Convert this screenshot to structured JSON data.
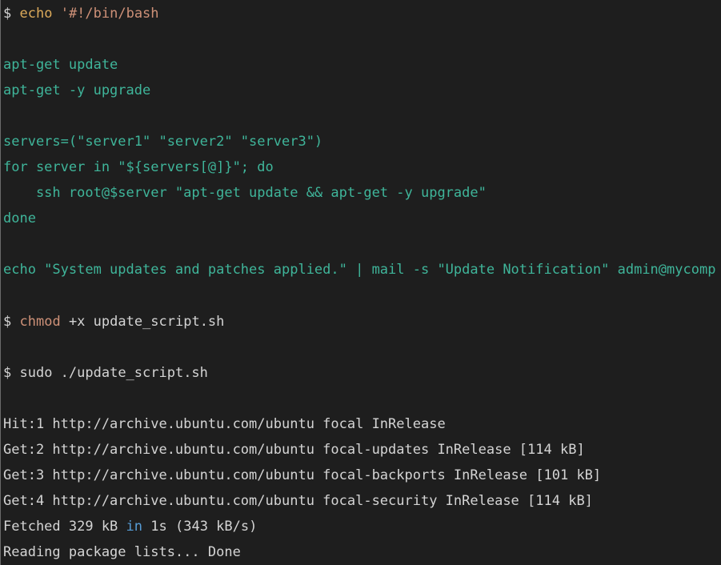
{
  "colors": {
    "background": "#1e1e1e",
    "default_text": "#d4d4d4",
    "string": "#ce9178",
    "command": "#dcaa5a",
    "script_body": "#3fb59a",
    "keyword": "#569cd6"
  },
  "lines": [
    {
      "prompt": "$",
      "cmd": "echo",
      "arg": "'#!/bin/bash"
    },
    {
      "text": "apt-get update"
    },
    {
      "text": "apt-get -y upgrade"
    },
    {
      "text": "servers=(\"server1\" \"server2\" \"server3\")"
    },
    {
      "text": "for server in \"${servers[@]}\"; do"
    },
    {
      "text": "    ssh root@$server \"apt-get update && apt-get -y upgrade\""
    },
    {
      "text": "done"
    },
    {
      "text": "echo \"System updates and patches applied.\" | mail -s \"Update Notification\" admin@mycomp"
    },
    {
      "prompt": "$",
      "cmd": "chmod",
      "arg": "+x update_script.sh"
    },
    {
      "prompt": "$",
      "text": "sudo ./update_script.sh"
    },
    {
      "text": "Hit:1 http://archive.ubuntu.com/ubuntu focal InRelease"
    },
    {
      "text": "Get:2 http://archive.ubuntu.com/ubuntu focal-updates InRelease [114 kB]"
    },
    {
      "text": "Get:3 http://archive.ubuntu.com/ubuntu focal-backports InRelease [101 kB]"
    },
    {
      "text": "Get:4 http://archive.ubuntu.com/ubuntu focal-security InRelease [114 kB]"
    },
    {
      "pre": "Fetched 329 kB",
      "kw": "in",
      "post": "1s (343 kB/s)"
    },
    {
      "text": "Reading package lists... Done"
    }
  ]
}
